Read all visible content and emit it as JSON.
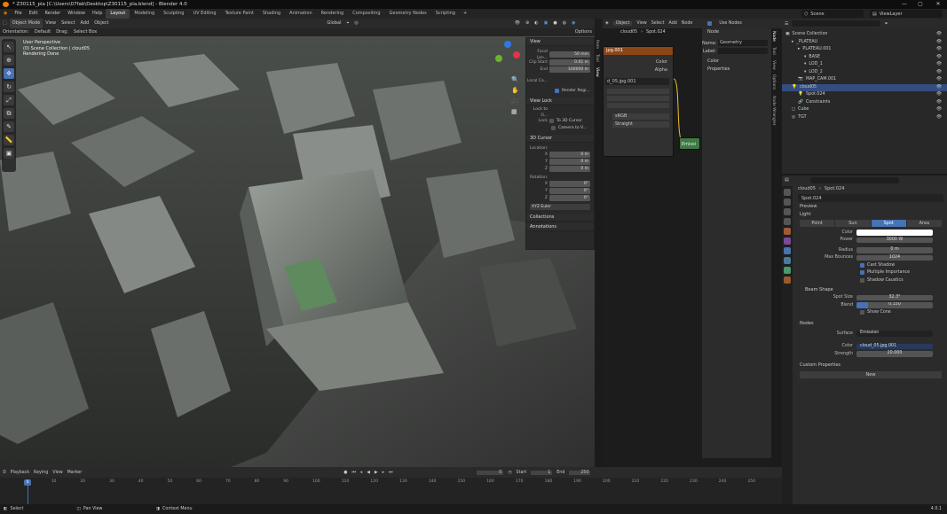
{
  "window": {
    "title": "* Z30115_pla [C:\\Users\\07fab\\Desktop\\Z30115_pla.blend] - Blender 4.0",
    "min": "—",
    "max": "▢",
    "close": "✕"
  },
  "menu": {
    "items": [
      "File",
      "Edit",
      "Render",
      "Window",
      "Help"
    ],
    "workspaces": [
      "Layout",
      "Modeling",
      "Sculpting",
      "UV Editing",
      "Texture Paint",
      "Shading",
      "Animation",
      "Rendering",
      "Compositing",
      "Geometry Nodes",
      "Scripting"
    ],
    "active_workspace": "Layout",
    "add_tab": "+",
    "scene_label": "Scene",
    "viewlayer_label": "ViewLayer"
  },
  "viewport": {
    "mode": "Object Mode",
    "menus": [
      "View",
      "Select",
      "Add",
      "Object"
    ],
    "transform": "Global",
    "orientation_label": "Orientation:",
    "orientation_value": "Default",
    "drag_label": "Drag:",
    "drag_value": "Select Box",
    "options_label": "Options",
    "overlay_line1": "User Perspective",
    "overlay_line2": "(0) Scene Collection | cloud05",
    "overlay_line3": "Rendering Done"
  },
  "npanel": {
    "view_header": "View",
    "focal_label": "Focal Len...",
    "focal_value": "50 mm",
    "clip_start_label": "Clip Start",
    "clip_start_value": "0.01 m",
    "clip_end_label": "End",
    "clip_end_value": "100000 m",
    "local_camera_label": "Local Ca...",
    "render_region_label": "Render Regi...",
    "view_lock_header": "View Lock",
    "lock_object_label": "Lock to O...",
    "lock_label": "Lock",
    "lock_cursor": "To 3D Cursor",
    "lock_camera": "Camera to V...",
    "cursor_header": "3D Cursor",
    "location_label": "Location:",
    "x_label": "X",
    "y_label": "Y",
    "z_label": "Z",
    "loc_x": "0 m",
    "loc_y": "0 m",
    "loc_z": "0 m",
    "rotation_label": "Rotation:",
    "rot_x": "0°",
    "rot_y": "0°",
    "rot_z": "0°",
    "rot_mode": "XYZ Euler",
    "collections_header": "Collections",
    "annotations_header": "Annotations",
    "tabs": [
      "Item",
      "Tool",
      "View"
    ]
  },
  "node_editor": {
    "header_menus": [
      "View",
      "Select",
      "Add",
      "Node"
    ],
    "object_label": "Object",
    "use_nodes_label": "Use Nodes",
    "breadcrumb_a": "cloud05",
    "breadcrumb_b": "Spot.024",
    "image_node_title": "jpg.001",
    "color_socket": "Color",
    "alpha_socket": "Alpha",
    "image_name": "d_05.jpg.001",
    "colorspace": "sRGB",
    "alpha_mode": "Straight",
    "emission_label": "Emissi",
    "node_panel_header": "Node",
    "name_label": "Name:",
    "name_value": "Geometry",
    "label_label": "Label:",
    "color_section": "Color",
    "properties_section": "Properties",
    "tabs": [
      "Node",
      "Tool",
      "View",
      "Options",
      "Node Wrangler"
    ]
  },
  "outliner": {
    "search_placeholder": "",
    "rows": [
      {
        "name": "Scene Collection",
        "indent": 0
      },
      {
        "name": "_PLATEAU",
        "indent": 1
      },
      {
        "name": "PLATEAU.001",
        "indent": 2
      },
      {
        "name": "BASE",
        "indent": 3
      },
      {
        "name": "LOD_1",
        "indent": 3
      },
      {
        "name": "LOD_2",
        "indent": 3
      },
      {
        "name": "MAP_CAM.001",
        "indent": 2
      },
      {
        "name": "cloud05",
        "indent": 1
      },
      {
        "name": "Spot.024",
        "indent": 2
      },
      {
        "name": "Constraints",
        "indent": 2
      },
      {
        "name": "Cube",
        "indent": 1
      },
      {
        "name": "TGT",
        "indent": 1
      }
    ],
    "selected_index": 7
  },
  "properties": {
    "breadcrumb_a": "cloud05",
    "breadcrumb_b": "Spot.024",
    "datablock": "Spot.024",
    "preview_header": "Preview",
    "light_header": "Light",
    "light_types": [
      "Point",
      "Sun",
      "Spot",
      "Area"
    ],
    "active_light_type": "Spot",
    "color_label": "Color",
    "power_label": "Power",
    "power_value": "3000 W",
    "radius_label": "Radius",
    "radius_value": "0 m",
    "max_bounces_label": "Max Bounces",
    "max_bounces_value": "1024",
    "cast_shadow": "Cast Shadow",
    "multiple_importance": "Multiple Importance",
    "shadow_caustics": "Shadow Caustics",
    "beam_shape_header": "Beam Shape",
    "spot_size_label": "Spot Size",
    "spot_size_value": "32.3°",
    "blend_label": "Blend",
    "blend_value": "0.150",
    "blend_fraction": 0.15,
    "show_cone": "Show Cone",
    "nodes_header": "Nodes",
    "surface_label": "Surface",
    "surface_value": "Emission",
    "ncolor_label": "Color",
    "ncolor_value": "cloud_05.jpg.001",
    "strength_label": "Strength",
    "strength_value": "20.000",
    "custom_props_header": "Custom Properties",
    "new_button": "New"
  },
  "timeline": {
    "menus": [
      "Playback",
      "Keying",
      "View",
      "Marker"
    ],
    "current_frame": "0",
    "start_label": "Start",
    "start_value": "1",
    "end_label": "End",
    "end_value": "250",
    "frame_indicator": "0",
    "ticks": [
      "10",
      "20",
      "30",
      "40",
      "50",
      "60",
      "70",
      "80",
      "90",
      "100",
      "110",
      "120",
      "130",
      "140",
      "150",
      "160",
      "170",
      "180",
      "190",
      "200",
      "210",
      "220",
      "230",
      "240",
      "250"
    ]
  },
  "status": {
    "select": "Select",
    "pan": "Pan View",
    "context": "Context Menu",
    "version": "4.0.1"
  }
}
